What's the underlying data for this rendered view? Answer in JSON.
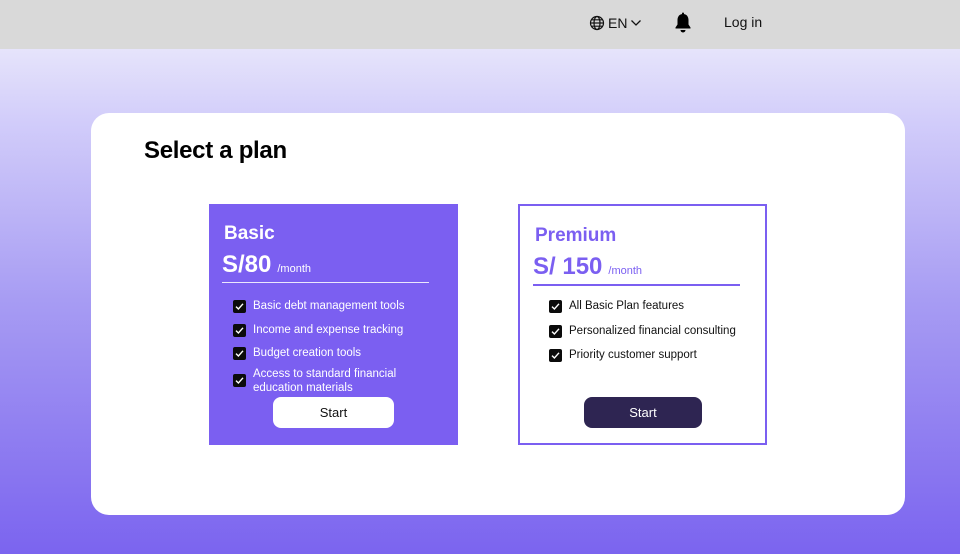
{
  "header": {
    "language": "EN",
    "login_label": "Log in",
    "icons": [
      "globe-icon",
      "chevron-down-icon",
      "bell-icon"
    ]
  },
  "main": {
    "title": "Select a plan",
    "plans": [
      {
        "name": "Basic",
        "price": "S/80",
        "period": "/month",
        "features": [
          "Basic debt management tools",
          "Income and expense tracking",
          "Budget creation tools",
          "Access to standard financial education materials"
        ],
        "button_label": "Start"
      },
      {
        "name": "Premium",
        "price": "S/ 150",
        "period": "/month",
        "features": [
          "All Basic Plan features",
          "Personalized financial consulting",
          "Priority customer support"
        ],
        "button_label": "Start"
      }
    ]
  },
  "colors": {
    "accent": "#7b5ff1",
    "dark_button": "#2e2552",
    "topbar": "#d9d9d9"
  }
}
